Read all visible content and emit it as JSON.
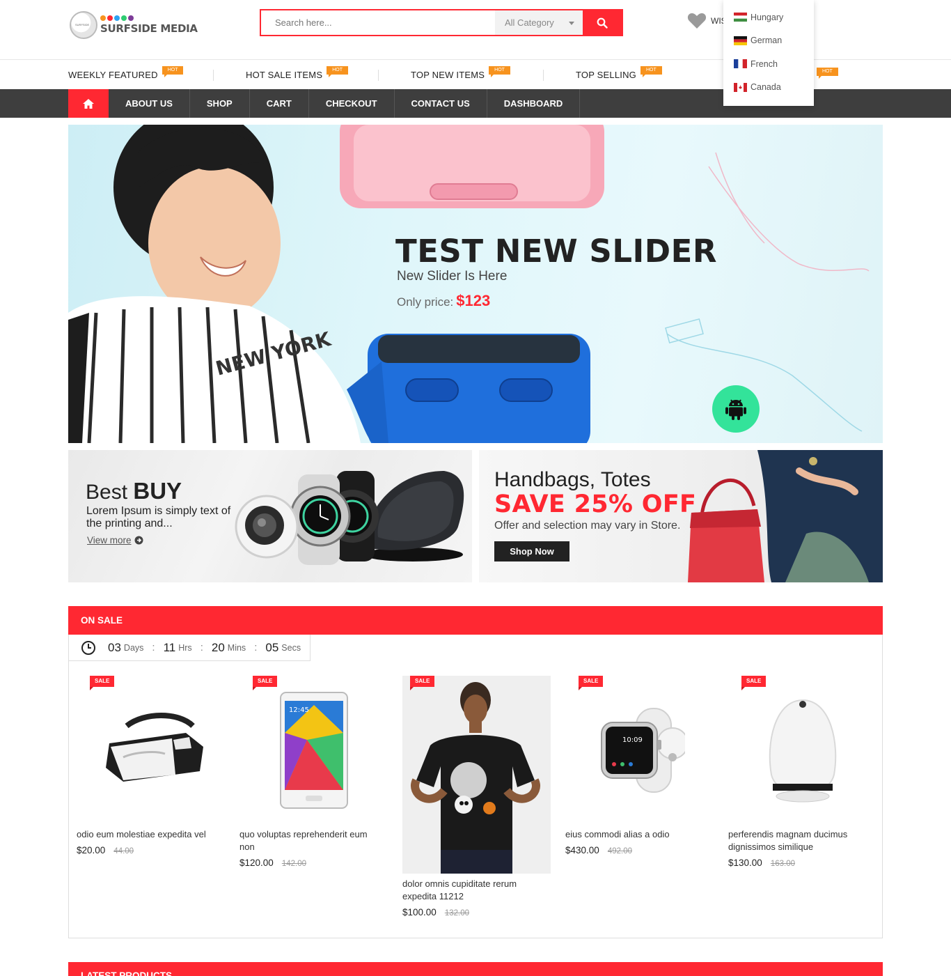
{
  "header": {
    "logo_text": "SURFSIDE MEDIA",
    "search_placeholder": "Search here...",
    "category_label": "All Category",
    "wishlist_label": "WIS"
  },
  "languages": [
    "Hungary",
    "German",
    "French",
    "Canada"
  ],
  "hot_row": [
    {
      "label": "Weekly Featured",
      "badge": "HOT"
    },
    {
      "label": "Hot Sale items",
      "badge": "HOT"
    },
    {
      "label": "Top new items",
      "badge": "HOT"
    },
    {
      "label": "Top Selling",
      "badge": "HOT"
    },
    {
      "label": "",
      "badge": "HOT"
    }
  ],
  "nav": [
    "About Us",
    "Shop",
    "Cart",
    "Checkout",
    "Contact Us",
    "Dashboard"
  ],
  "slider": {
    "title": "TEST NEW SLIDER",
    "subtitle": "New Slider Is Here",
    "price_label": "Only price:",
    "price": "$123"
  },
  "banner_left": {
    "title_light": "Best ",
    "title_bold": "BUY",
    "desc": "Lorem Ipsum is simply text of the printing and...",
    "link": "View more"
  },
  "banner_right": {
    "title": "Handbags, Totes",
    "save": "SAVE 25% OFF",
    "note": "Offer and selection may vary in Store.",
    "button": "Shop Now"
  },
  "on_sale": {
    "title": "ON SALE",
    "countdown": [
      {
        "value": "03",
        "unit": "Days"
      },
      {
        "value": "11",
        "unit": "Hrs"
      },
      {
        "value": "20",
        "unit": "Mins"
      },
      {
        "value": "05",
        "unit": "Secs"
      }
    ],
    "sale_tag": "SALE",
    "products": [
      {
        "name": "odio eum molestiae expedita vel",
        "price": "$20.00",
        "old": "44.00",
        "icon": "vr-headset"
      },
      {
        "name": "quo voluptas reprehenderit eum non",
        "price": "$120.00",
        "old": "142.00",
        "icon": "tablet"
      },
      {
        "name": "dolor omnis cupiditate rerum expedita 11212",
        "price": "$100.00",
        "old": "132.00",
        "icon": "tshirt-model"
      },
      {
        "name": "eius commodi alias a odio",
        "price": "$430.00",
        "old": "492.00",
        "icon": "smartwatch"
      },
      {
        "name": "perferendis magnam ducimus dignissimos similique",
        "price": "$130.00",
        "old": "163.00",
        "icon": "speaker"
      }
    ]
  },
  "latest": {
    "title": "LATEST PRODUCTS"
  },
  "colors": {
    "accent": "#ff2832",
    "nav_bg": "#3e3e3e",
    "hot_badge": "#f7931e",
    "android": "#33e39a"
  }
}
